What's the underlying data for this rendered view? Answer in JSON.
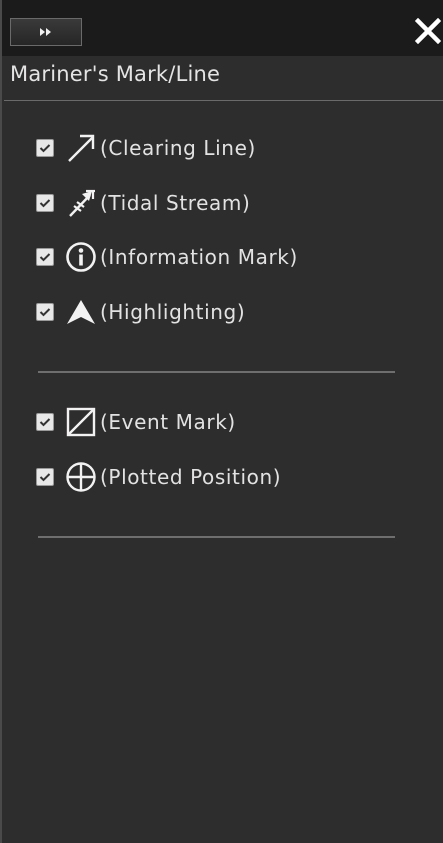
{
  "header": {
    "expand_icon": "fast-forward-icon",
    "close_icon": "close-x-icon"
  },
  "panel": {
    "title": "Mariner's Mark/Line"
  },
  "groups": [
    {
      "items": [
        {
          "symbol": "clearing-line-arrow",
          "label": "(Clearing Line)",
          "checked": true
        },
        {
          "symbol": "tidal-stream-arrow",
          "label": "(Tidal Stream)",
          "checked": true
        },
        {
          "symbol": "information-mark",
          "label": "(Information Mark)",
          "checked": true
        },
        {
          "symbol": "highlighting-arrowhead",
          "label": "(Highlighting)",
          "checked": true
        }
      ]
    },
    {
      "items": [
        {
          "symbol": "event-mark-square",
          "label": "(Event Mark)",
          "checked": true
        },
        {
          "symbol": "plotted-position-circle",
          "label": "(Plotted Position)",
          "checked": true
        }
      ]
    }
  ],
  "colors": {
    "panel_bg": "#2e2d2d",
    "topbar_bg": "#1b1b1b",
    "text": "#e2e2e2",
    "divider": "#6e6e6e",
    "checkbox_bg": "#e8e8e8"
  }
}
